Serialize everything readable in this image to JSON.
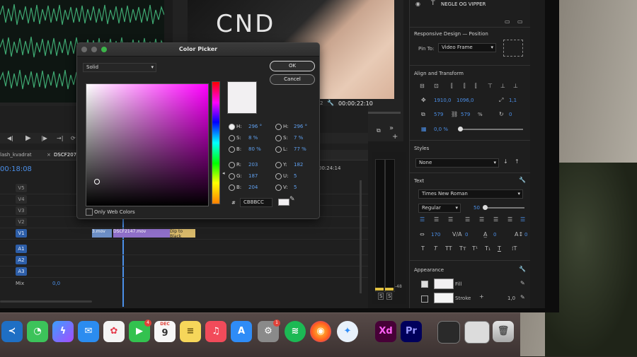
{
  "monitor": {
    "video_overlay_text": "CND",
    "timecode": "00:00:22:10",
    "left_timecode_fragment": "2"
  },
  "timeline": {
    "tabs": [
      "lash_kvadrat",
      "DSCF2072"
    ],
    "current_time": "00:18:08",
    "ruler_time": "00:24:14",
    "video_tracks": [
      "V5",
      "V4",
      "V3",
      "V2",
      "V1"
    ],
    "audio_tracks": [
      "A1",
      "A2",
      "A3"
    ],
    "mix_label": "Mix",
    "mix_value": "0,0",
    "clips": [
      {
        "label": "3.mov"
      },
      {
        "label": "DSCF2147.mov"
      },
      {
        "label": "Dip to Black"
      }
    ]
  },
  "meters": {
    "scale_bottom": "-48",
    "solo_labels": [
      "S",
      "S"
    ]
  },
  "panel": {
    "layer_name": "NEGLE OG VIPPER",
    "responsive_title": "Responsive Design — Position",
    "pin_to_label": "Pin To:",
    "pin_to_value": "Video Frame",
    "align_title": "Align and Transform",
    "pos_x": "1910,0",
    "pos_y": "1096,0",
    "rot": "1,1",
    "size_w": "579",
    "size_h": "579",
    "size_unit": "%",
    "rot_val": "0",
    "opacity": "0,0 %",
    "styles_title": "Styles",
    "styles_value": "None",
    "text_title": "Text",
    "font": "Times New Roman",
    "font_style": "Regular",
    "font_size": "50",
    "tracking": "170",
    "kerning": "0",
    "leading": "0",
    "baseline": "0",
    "appearance_title": "Appearance",
    "fill_label": "Fill",
    "stroke_label": "Stroke",
    "stroke_value": "1,0"
  },
  "color_picker": {
    "title": "Color Picker",
    "mode": "Solid",
    "ok": "OK",
    "cancel": "Cancel",
    "web_colors": "Only Web Colors",
    "hex_label": "#",
    "hex": "CBBBCC",
    "swatch_color": "#f2f0f2",
    "hsb_left": [
      {
        "label": "H:",
        "value": "296 °",
        "selected": true
      },
      {
        "label": "S:",
        "value": "8 %",
        "selected": false
      },
      {
        "label": "B:",
        "value": "80 %",
        "selected": false
      }
    ],
    "rgb": [
      {
        "label": "R:",
        "value": "203"
      },
      {
        "label": "G:",
        "value": "187"
      },
      {
        "label": "B:",
        "value": "204"
      }
    ],
    "hsl": [
      {
        "label": "H:",
        "value": "296 °"
      },
      {
        "label": "S:",
        "value": "7 %"
      },
      {
        "label": "L:",
        "value": "77 %"
      }
    ],
    "yuv": [
      {
        "label": "Y:",
        "value": "182"
      },
      {
        "label": "U:",
        "value": "5"
      },
      {
        "label": "V:",
        "value": "5"
      }
    ]
  },
  "dock": {
    "calendar_month": "DEC",
    "calendar_day": "9",
    "facetime_badge": "4",
    "settings_badge": "1",
    "apps": [
      "vscode",
      "messages",
      "messenger",
      "mail",
      "photos",
      "facetime",
      "calendar",
      "notes",
      "music",
      "app-store",
      "system-preferences",
      "spotify",
      "firefox",
      "safari",
      "adobe-xd",
      "premiere-pro",
      "finder-window",
      "preview-window",
      "trash"
    ],
    "xd_label": "Xd",
    "pr_label": "Pr"
  }
}
